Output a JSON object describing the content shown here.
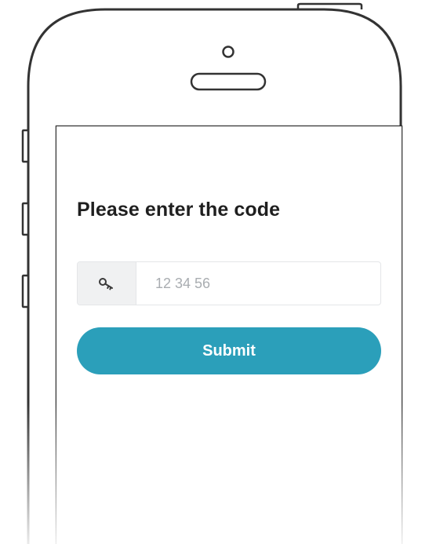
{
  "screen": {
    "title": "Please enter the code",
    "code_field": {
      "icon": "key-icon",
      "placeholder": "12 34 56",
      "value": ""
    },
    "submit_label": "Submit"
  },
  "colors": {
    "accent": "#2b9fba",
    "icon_background": "#f0f1f2",
    "title_text": "#1f1f1f",
    "placeholder_text": "#a9adb1"
  }
}
